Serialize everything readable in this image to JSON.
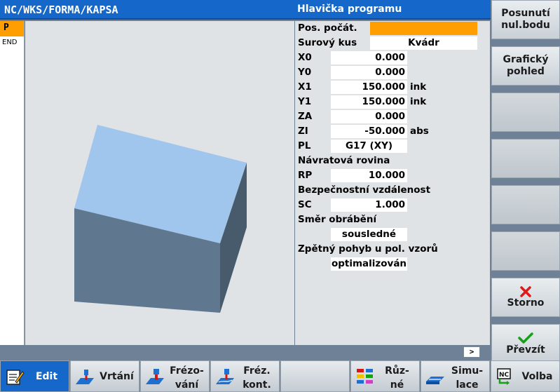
{
  "header": {
    "path": "NC/WKS/FORMA/KAPSA",
    "title": "Hlavička programu"
  },
  "program": {
    "current": "P",
    "end": "END"
  },
  "form": {
    "pos_pocat_label": "Pos. počát.",
    "surovy_kus_label": "Surový kus",
    "surovy_kus_value": "Kvádr",
    "x0_label": "X0",
    "x0_value": "0.000",
    "y0_label": "Y0",
    "y0_value": "0.000",
    "x1_label": "X1",
    "x1_value": "150.000",
    "x1_unit": "ink",
    "y1_label": "Y1",
    "y1_value": "150.000",
    "y1_unit": "ink",
    "za_label": "ZA",
    "za_value": "0.000",
    "zi_label": "ZI",
    "zi_value": "-50.000",
    "zi_unit": "abs",
    "pl_label": "PL",
    "pl_value": "G17 (XY)",
    "navratova_label": "Návratová rovina",
    "rp_label": "RP",
    "rp_value": "10.000",
    "bezpecnost_label": "Bezpečnostní vzdálenost",
    "sc_label": "SC",
    "sc_value": "1.000",
    "smer_label": "Směr obrábění",
    "smer_value": "sousledné",
    "zpetny_label": "Zpětný pohyb u pol. vzorů",
    "zpetny_value": "optimalizován"
  },
  "scroll_indicator": ">",
  "vertical_softkeys": {
    "posunuti_l1": "Posunutí",
    "posunuti_l2": "nul.bodu",
    "graficky_l1": "Grafický",
    "graficky_l2": "pohled",
    "storno": "Storno",
    "prevzit": "Převzít"
  },
  "horizontal_softkeys": {
    "edit": "Edit",
    "vrtani": "Vrtání",
    "frezovani_l1": "Frézo-",
    "frezovani_l2": "vání",
    "frez_kont_l1": "Fréz.",
    "frez_kont_l2": "kont.",
    "ruzne_l1": "Růz-",
    "ruzne_l2": "né",
    "simulace_l1": "Simu-",
    "simulace_l2": "lace",
    "volba": "Volba"
  },
  "colors": {
    "header": "#1567c9",
    "accent": "#ff9e00",
    "cube_top": "#a0c6ee",
    "cube_front": "#5f7890",
    "cube_side": "#485b6c"
  }
}
